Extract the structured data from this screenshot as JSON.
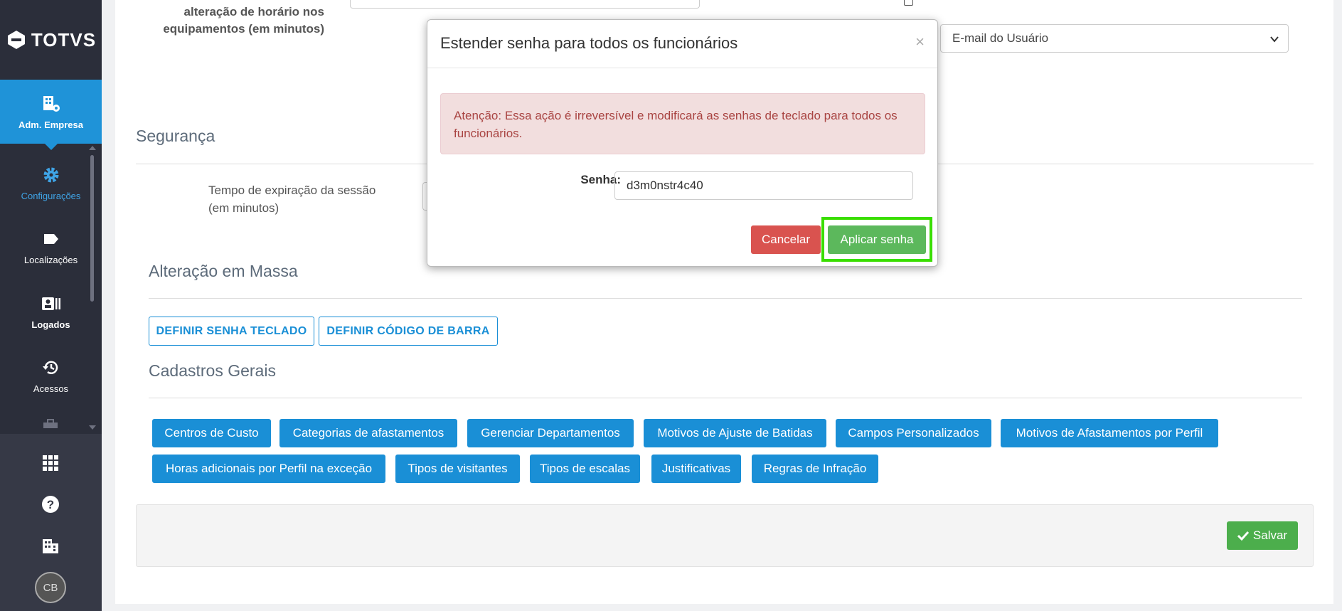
{
  "sidebar": {
    "logo_text": "TOTVS",
    "items": [
      {
        "label": "Adm. Empresa",
        "icon": "building-gear-icon"
      },
      {
        "label": "Configurações",
        "icon": "gear-icon"
      },
      {
        "label": "Localizações",
        "icon": "tag-icon"
      },
      {
        "label": "Logados",
        "icon": "id-card-icon"
      },
      {
        "label": "Acessos",
        "icon": "history-icon"
      }
    ],
    "bottom_icons": [
      "apps-grid-icon",
      "help-icon",
      "office-building-icon"
    ],
    "avatar_initials": "CB"
  },
  "form": {
    "time_change_label": "alteração de horário nos equipamentos (em minutos)",
    "email_select_value": "E-mail do Usuário"
  },
  "sections": {
    "seguranca": "Segurança",
    "session_label": "Tempo de expiração da sessão (em minutos)",
    "alteracao_massa": "Alteração em Massa",
    "cadastros_gerais": "Cadastros Gerais"
  },
  "mass_buttons": {
    "senha_teclado": "DEFINIR SENHA TECLADO",
    "codigo_barra": "DEFINIR CÓDIGO DE BARRA"
  },
  "cadastros": [
    "Centros de Custo",
    "Categorias de afastamentos",
    "Gerenciar Departamentos",
    "Motivos de Ajuste de Batidas",
    "Campos Personalizados",
    "Motivos de Afastamentos por Perfil",
    "Horas adicionais por Perfil na exceção",
    "Tipos de visitantes",
    "Tipos de escalas",
    "Justificativas",
    "Regras de Infração"
  ],
  "footer": {
    "save_label": "Salvar"
  },
  "modal": {
    "title": "Estender senha para todos os funcionários",
    "close": "×",
    "alert": "Atenção: Essa ação é irreversível e modificará as senhas de teclado para todos os funcionários.",
    "password_label": "Senha:",
    "password_value": "d3m0nstr4c40",
    "cancel_label": "Cancelar",
    "apply_label": "Aplicar senha"
  },
  "colors": {
    "sidebar_bg": "#2b2e3a",
    "active_blue": "#1f93d8",
    "primary_blue": "#1a8fd6",
    "danger": "#d9534f",
    "success": "#5cb85c",
    "highlight": "#3ade00"
  }
}
